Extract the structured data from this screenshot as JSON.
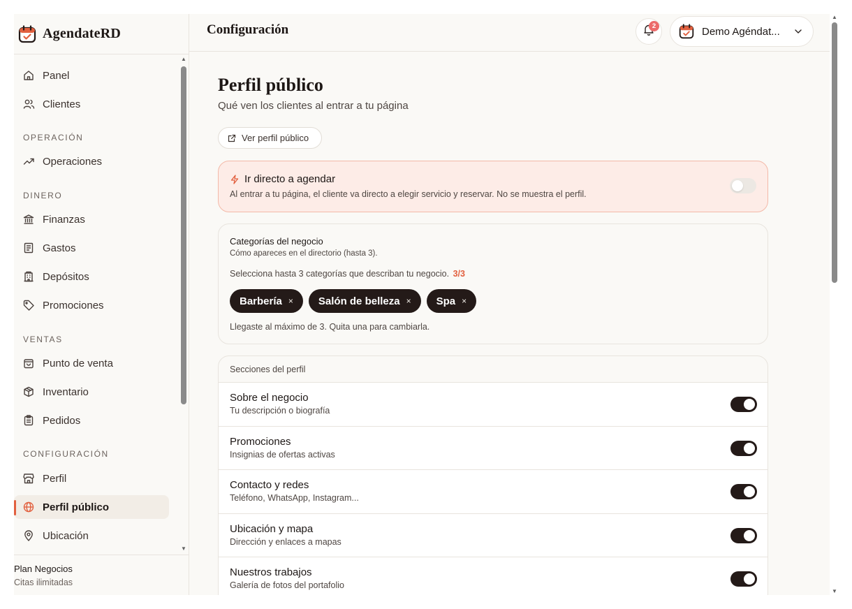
{
  "app": {
    "name": "AgendateRD"
  },
  "topbar": {
    "title": "Configuración",
    "notif_count": "2",
    "account_name": "Demo Agéndat..."
  },
  "sidebar": {
    "items": [
      {
        "label": "Panel",
        "icon": "home-icon"
      },
      {
        "label": "Clientes",
        "icon": "users-icon"
      },
      {
        "section": "OPERACIÓN"
      },
      {
        "label": "Operaciones",
        "icon": "trending-up-icon"
      },
      {
        "section": "DINERO"
      },
      {
        "label": "Finanzas",
        "icon": "bank-icon"
      },
      {
        "label": "Gastos",
        "icon": "receipt-icon"
      },
      {
        "label": "Depósitos",
        "icon": "building-icon"
      },
      {
        "label": "Promociones",
        "icon": "tag-icon"
      },
      {
        "section": "VENTAS"
      },
      {
        "label": "Punto de venta",
        "icon": "shopping-bag-icon"
      },
      {
        "label": "Inventario",
        "icon": "package-icon"
      },
      {
        "label": "Pedidos",
        "icon": "clipboard-icon"
      },
      {
        "section": "CONFIGURACIÓN"
      },
      {
        "label": "Perfil",
        "icon": "store-icon"
      },
      {
        "label": "Perfil público",
        "icon": "globe-icon",
        "active": true
      },
      {
        "label": "Ubicación",
        "icon": "map-pin-icon"
      }
    ],
    "plan": {
      "name": "Plan Negocios",
      "sub": "Citas ilimitadas"
    }
  },
  "main": {
    "heading": "Perfil público",
    "subheading": "Qué ven los clientes al entrar a tu página",
    "view_button": "Ver perfil público",
    "direct": {
      "title": "Ir directo a agendar",
      "description": "Al entrar a tu página, el cliente va directo a elegir servicio y reservar. No se muestra el perfil.",
      "enabled": false
    },
    "categories": {
      "title": "Categorías del negocio",
      "subtitle": "Cómo apareces en el directorio (hasta 3).",
      "instruction": "Selecciona hasta 3 categorías que describan tu negocio.",
      "count": "3/3",
      "selected": [
        "Barbería",
        "Salón de belleza",
        "Spa"
      ],
      "remove_glyph": "×",
      "note": "Llegaste al máximo de 3. Quita una para cambiarla."
    },
    "sections": {
      "title": "Secciones del perfil",
      "rows": [
        {
          "title": "Sobre el negocio",
          "subtitle": "Tu descripción o biografía",
          "enabled": true
        },
        {
          "title": "Promociones",
          "subtitle": "Insignias de ofertas activas",
          "enabled": true
        },
        {
          "title": "Contacto y redes",
          "subtitle": "Teléfono, WhatsApp, Instagram...",
          "enabled": true
        },
        {
          "title": "Ubicación y mapa",
          "subtitle": "Dirección y enlaces a mapas",
          "enabled": true
        },
        {
          "title": "Nuestros trabajos",
          "subtitle": "Galería de fotos del portafolio",
          "enabled": true
        }
      ]
    }
  },
  "colors": {
    "accent": "#e2603f",
    "dark": "#241a18",
    "background": "#faf9f6",
    "alert_bg": "#fdece7",
    "alert_border": "#f3b9a8"
  }
}
